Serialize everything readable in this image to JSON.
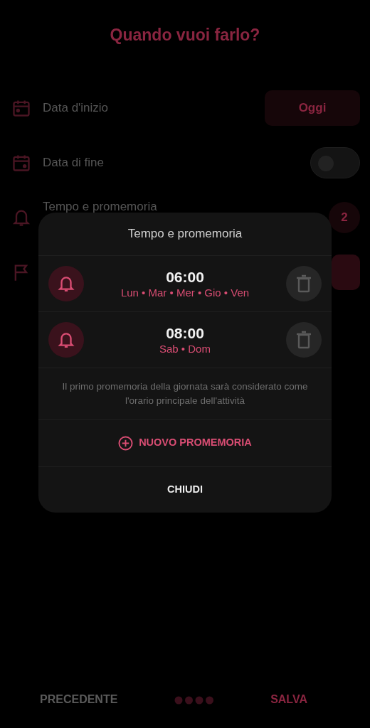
{
  "screen": {
    "title": "Quando vuoi farlo?"
  },
  "settings": [
    {
      "kind": "button",
      "label": "Data d'inizio",
      "value": "Oggi"
    },
    {
      "kind": "toggle",
      "label": "Data di fine",
      "on": false
    },
    {
      "kind": "count",
      "label": "Tempo e promemoria",
      "value": "2"
    },
    {
      "kind": "button"
    }
  ],
  "dialog": {
    "title": "Tempo e promemoria",
    "reminders": [
      {
        "time": "06:00",
        "days": "Lun • Mar • Mer • Gio • Ven"
      },
      {
        "time": "08:00",
        "days": "Sab • Dom"
      }
    ],
    "note": "Il primo promemoria della giornata sarà considerato come l'orario principale dell'attività",
    "add_button": "NUOVO PROMEMORIA",
    "close_button": "CHIUDI"
  },
  "footer": {
    "back": "PRECEDENTE",
    "save": "SALVA"
  }
}
